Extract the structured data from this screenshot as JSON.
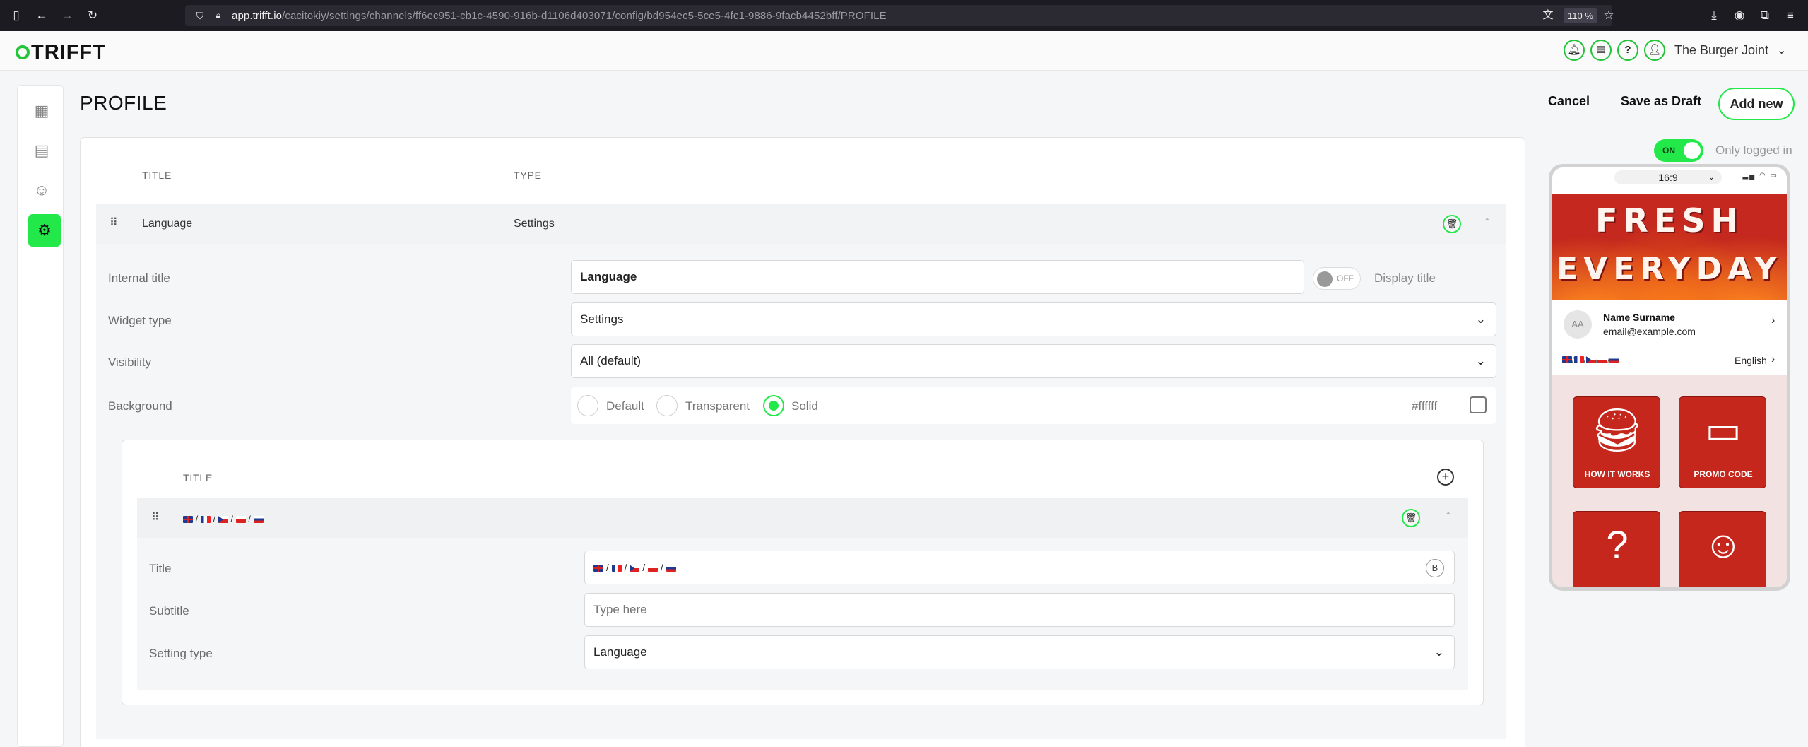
{
  "browser": {
    "url_host": "app.trifft.io",
    "url_path": "/cacitokiy/settings/channels/ff6ec951-cb1c-4590-916b-d1106d403071/config/bd954ec5-5ce5-4fc1-9886-9facb4452bff/PROFILE",
    "zoom": "110 %"
  },
  "header": {
    "logo": "TRIFFT",
    "restaurant": "The Burger Joint"
  },
  "page": {
    "title": "PROFILE",
    "cancel": "Cancel",
    "save_draft": "Save as Draft",
    "add_new": "Add new"
  },
  "table": {
    "col_title": "TITLE",
    "col_type": "TYPE",
    "row": {
      "title": "Language",
      "type": "Settings"
    }
  },
  "form": {
    "internal_title_label": "Internal title",
    "internal_title_value": "Language",
    "display_title_toggle": "OFF",
    "display_title_label": "Display title",
    "widget_type_label": "Widget type",
    "widget_type_value": "Settings",
    "visibility_label": "Visibility",
    "visibility_value": "All (default)",
    "background_label": "Background",
    "bg_default": "Default",
    "bg_transparent": "Transparent",
    "bg_solid": "Solid",
    "bg_color": "#ffffff",
    "bg_selected": "Solid"
  },
  "subtable": {
    "col_title": "TITLE",
    "row_separator": "/",
    "title_label": "Title",
    "title_b": "B",
    "subtitle_label": "Subtitle",
    "subtitle_placeholder": "Type here",
    "setting_type_label": "Setting type",
    "setting_type_value": "Language"
  },
  "preview": {
    "toggle": "ON",
    "only_logged_in": "Only logged in",
    "ratio": "16:9",
    "banner_line1": "FRESH",
    "banner_line2": "EVERYDAY",
    "avatar_initials": "AA",
    "name": "Name Surname",
    "email": "email@example.com",
    "language": "English",
    "tiles": [
      "HOW IT WORKS",
      "PROMO CODE"
    ]
  },
  "colors": {
    "accent": "#23e84a",
    "banner": "#c4281e"
  },
  "icons": [
    "sidebar-toggle-icon",
    "back-icon",
    "forward-icon",
    "reload-icon",
    "shield-icon",
    "lock-icon",
    "translate-icon",
    "star-icon",
    "download-icon",
    "profile-icon",
    "extensions-icon",
    "menu-icon",
    "bell-icon",
    "chat-icon",
    "help-icon",
    "user-icon",
    "dashboard-icon",
    "document-icon",
    "smiley-icon",
    "gear-icon",
    "drag-handle-icon",
    "trash-icon",
    "chevron-up-icon",
    "chevron-down-icon",
    "plus-icon"
  ]
}
